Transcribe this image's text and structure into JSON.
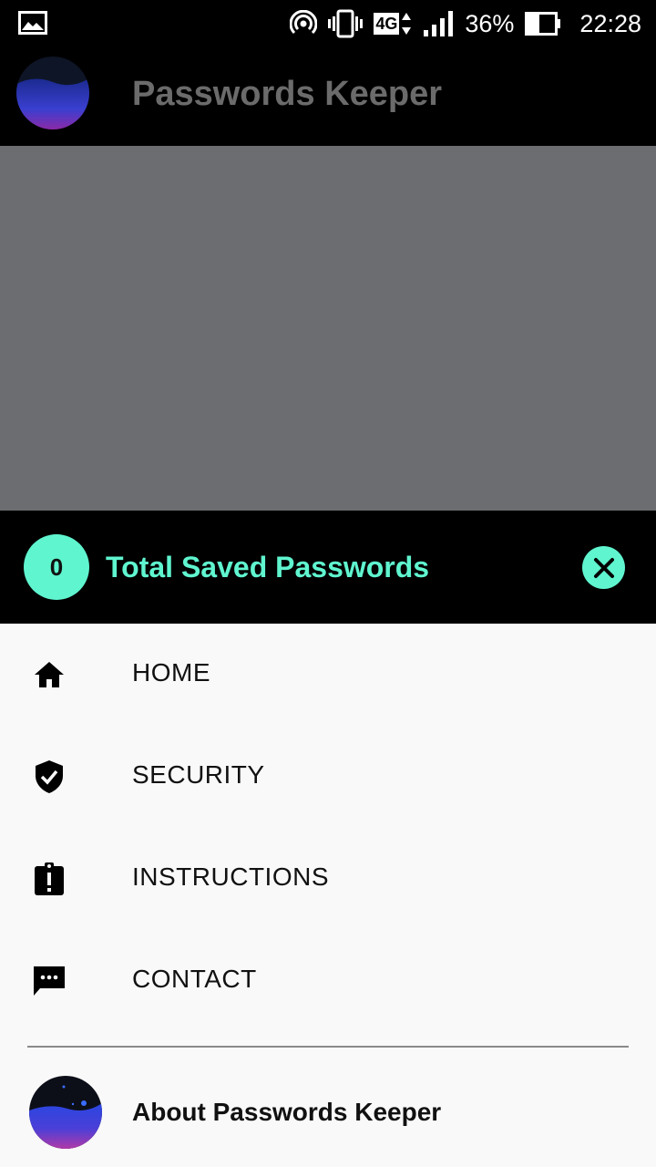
{
  "status_bar": {
    "battery_percent": "36%",
    "time": "22:28",
    "network": "4G",
    "icons": [
      "gallery-notification-icon",
      "hotspot-icon",
      "vibrate-icon",
      "network-4g-icon",
      "signal-icon",
      "battery-icon"
    ]
  },
  "app_bar": {
    "title": "Passwords Keeper",
    "logo": "app-logo-icon"
  },
  "drawer": {
    "header": {
      "count": "0",
      "label": "Total Saved Passwords",
      "close_icon": "close-icon"
    },
    "items": [
      {
        "label": "HOME",
        "icon": "home-icon"
      },
      {
        "label": "SECURITY",
        "icon": "shield-check-icon"
      },
      {
        "label": "INSTRUCTIONS",
        "icon": "clipboard-alert-icon"
      },
      {
        "label": "CONTACT",
        "icon": "chat-icon"
      }
    ],
    "about": {
      "label": "About Passwords Keeper",
      "icon": "app-logo-icon"
    }
  },
  "colors": {
    "accent": "#5ff5cf",
    "dim_overlay": "#6c6d71",
    "drawer_bg": "#f9f9f9",
    "bar_bg": "#000000"
  }
}
